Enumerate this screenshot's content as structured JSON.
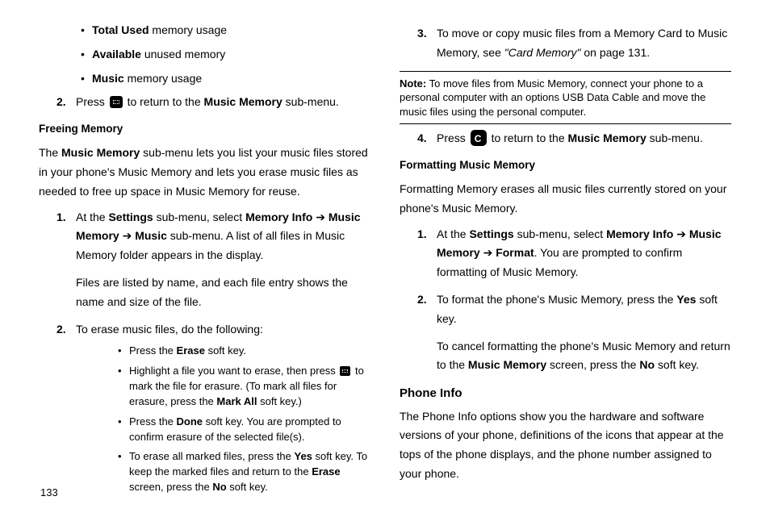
{
  "left": {
    "bullets_top": [
      {
        "bold": "Total Used",
        "rest": " memory usage"
      },
      {
        "bold": "Available",
        "rest": " unused memory"
      },
      {
        "bold": "Music",
        "rest": " memory usage"
      }
    ],
    "step2_a": "Press ",
    "step2_b": " to return to the ",
    "step2_bold": "Music Memory",
    "step2_c": " sub-menu.",
    "h_free": "Freeing Memory",
    "p_free_a": "The ",
    "p_free_bold": "Music Memory",
    "p_free_b": " sub-menu lets you list your music files stored in your phone's Music Memory and lets you erase music files as needed to free up space in Music Memory for reuse.",
    "n1_a": "At the ",
    "n1_b": "Settings",
    "n1_c": " sub-menu, select ",
    "n1_d": "Memory Info",
    "n1_e": "Music Memory",
    "n1_f": "Music",
    "n1_g": " sub-menu. A list of all files in Music Memory folder appears in the display.",
    "n1_p2": "Files are listed by name, and each file entry shows the name and size of the file.",
    "n2": "To erase music files, do the following:",
    "sub": {
      "s1a": "Press the ",
      "s1b": "Erase",
      "s1c": " soft key.",
      "s2a": "Highlight a file you want to erase, then press ",
      "s2b": " to mark the file for erasure. (To mark all files for erasure, press the ",
      "s2c": "Mark All",
      "s2d": " soft key.)",
      "s3a": "Press the ",
      "s3b": "Done",
      "s3c": " soft key. You are prompted to confirm erasure of the selected file(s).",
      "s4a": "To erase all marked files, press the ",
      "s4b": "Yes",
      "s4c": " soft key. To keep the marked files and return to the ",
      "s4d": "Erase",
      "s4e": " screen, press the ",
      "s4f": "No",
      "s4g": " soft key."
    }
  },
  "right": {
    "n3a": "To move or copy music files from a Memory Card to Music Memory, see ",
    "n3b": "\"Card Memory\"",
    "n3c": " on page 131.",
    "note_lbl": "Note:",
    "note_txt": "To move files from Music Memory, connect your phone to a personal computer with an options USB Data Cable and move the music files using the personal computer.",
    "n4a": "Press ",
    "n4b": " to return to the ",
    "n4c": "Music Memory",
    "n4d": " sub-menu.",
    "h_fmt": "Formatting Music Memory",
    "p_fmt": "Formatting Memory erases all music files currently stored on your phone's Music Memory.",
    "f1a": "At the ",
    "f1b": "Settings",
    "f1c": " sub-menu, select ",
    "f1d": "Memory Info",
    "f1e": "Music Memory",
    "f1f": "Format",
    "f1g": ". You are prompted to confirm formatting of Music Memory.",
    "f2a": "To format the phone's Music Memory, press the ",
    "f2b": "Yes",
    "f2c": " soft key.",
    "f2d": "To cancel formatting the phone's Music Memory and return to the ",
    "f2e": "Music Memory",
    "f2f": " screen, press the ",
    "f2g": "No",
    "f2h": " soft key.",
    "h_phone": "Phone Info",
    "p_phone": "The Phone Info options show you the hardware and software versions of your phone, definitions of the icons that appear at the tops of the phone displays, and the phone number assigned to your phone."
  },
  "arrow": " ➔ ",
  "nums": {
    "n1": "1.",
    "n2": "2.",
    "n3": "3.",
    "n4": "4."
  },
  "page_number": "133"
}
